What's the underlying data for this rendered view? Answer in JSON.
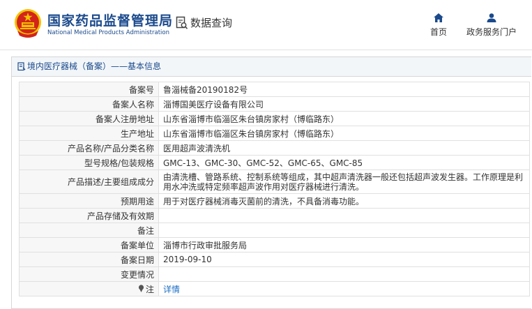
{
  "header": {
    "org_name_cn": "国家药品监督管理局",
    "org_name_en": "National Medical Products Administration",
    "db_title": "数据查询",
    "nav": [
      {
        "label": "首页",
        "icon": "home-icon"
      },
      {
        "label": "政务服务门户",
        "icon": "user-icon"
      }
    ]
  },
  "panel": {
    "title": "境内医疗器械（备案）——基本信息"
  },
  "rows": [
    {
      "label": "备案号",
      "value": "鲁淄械备20190182号"
    },
    {
      "label": "备案人名称",
      "value": "淄博国美医疗设备有限公司"
    },
    {
      "label": "备案人注册地址",
      "value": "山东省淄博市临淄区朱台镇房家村（博临路东）"
    },
    {
      "label": "生产地址",
      "value": "山东省淄博市临淄区朱台镇房家村（博临路东）"
    },
    {
      "label": "产品名称/产品分类名称",
      "value": "医用超声波清洗机"
    },
    {
      "label": "型号规格/包装规格",
      "value": "GMC-13、GMC-30、GMC-52、GMC-65、GMC-85"
    },
    {
      "label": "产品描述/主要组成成分",
      "value": "由清洗槽、管路系统、控制系统等组成，其中超声清洗器一般还包括超声波发生器。工作原理是利用水冲洗或特定频率超声波作用对医疗器械进行清洗。"
    },
    {
      "label": "预期用途",
      "value": "用于对医疗器械消毒灭菌前的清洗，不具备消毒功能。"
    },
    {
      "label": "产品存储及有效期",
      "value": ""
    },
    {
      "label": "备注",
      "value": ""
    },
    {
      "label": "备案单位",
      "value": "淄博市行政审批服务局"
    },
    {
      "label": "备案日期",
      "value": "2019-09-10"
    },
    {
      "label": "变更情况",
      "value": ""
    },
    {
      "label": "注",
      "value": "详情",
      "icon": "pin-icon"
    }
  ],
  "colors": {
    "brand_blue": "#1b4a8c",
    "link_blue": "#1b6ec2",
    "emblem_red": "#d3241c",
    "emblem_gold": "#f2c200"
  }
}
